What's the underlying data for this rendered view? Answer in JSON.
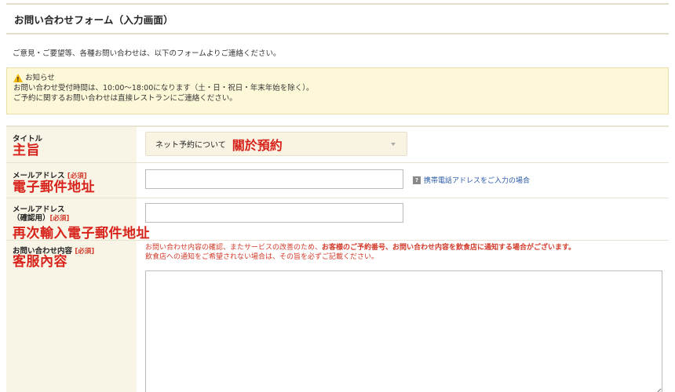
{
  "header": {
    "title": "お問い合わせフォーム（入力画面）"
  },
  "intro": "ご意見・ご要望等、各種お問い合わせは、以下のフォームよりご連絡ください。",
  "notice": {
    "title": "お知らせ",
    "line1": "お問い合わせ受付時間は、10:00〜18:00になります（土・日・祝日・年末年始を除く）。",
    "line2": "ご予約に関するお問い合わせは直接レストランにご連絡ください。"
  },
  "form": {
    "title_field": {
      "label": "タイトル",
      "overlay": "主旨",
      "value": "ネット予約について",
      "value_overlay": "關於預約"
    },
    "email_field": {
      "label": "メールアドレス",
      "required": "[必須]",
      "overlay": "電子郵件地址",
      "value": "",
      "help": "携帯電話アドレスをご入力の場合",
      "help_icon": "?"
    },
    "email_confirm_field": {
      "label_line1": "メールアドレス",
      "label_line2": "（確認用）",
      "required": "[必須]",
      "overlay": "再次輸入電子郵件地址",
      "value": ""
    },
    "inquiry_field": {
      "label": "お問い合わせ内容",
      "required": "[必須]",
      "overlay": "客服內容",
      "note_part1": "お問い合わせ内容の確認、またサービスの改善のため、",
      "note_bold": "お客様のご予約番号、お問い合わせ内容を飲食店に通知する場合がございます。",
      "note_line2": "飲食店への通知をご希望されない場合は、その旨を必ずご記載ください。",
      "value": ""
    }
  },
  "colors": {
    "accent_red": "#d8231c",
    "label_bg": "#f8f4e6",
    "notice_bg": "#fdf8d8",
    "link": "#2a5aa8"
  }
}
